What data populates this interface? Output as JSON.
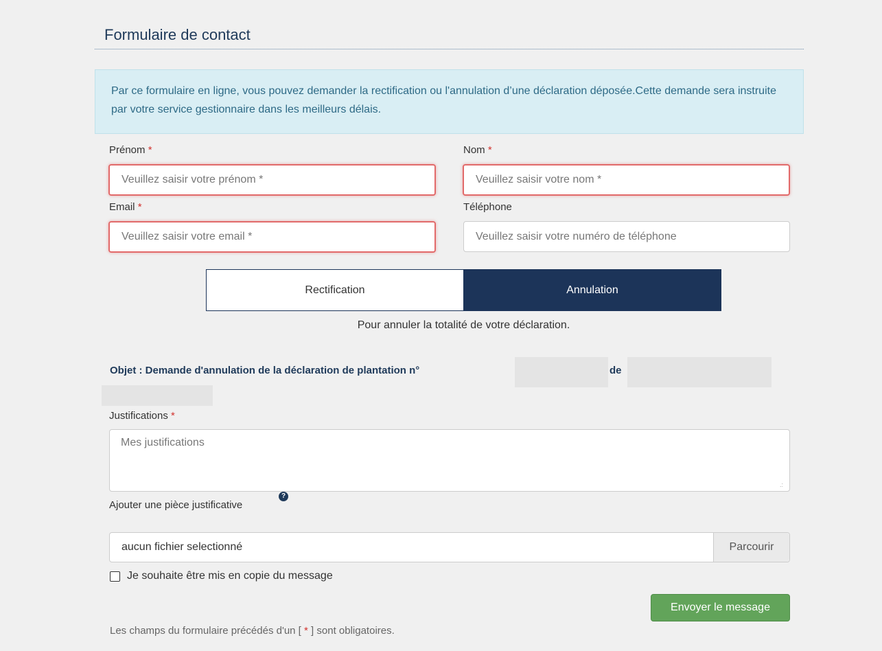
{
  "form": {
    "title": "Formulaire de contact",
    "info": "Par ce formulaire en ligne, vous pouvez demander la rectification ou l'annulation d’une déclaration déposée.Cette demande sera instruite par votre service gestionnaire dans les meilleurs délais.",
    "required_mark": "*",
    "fields": {
      "prenom": {
        "label": "Prénom",
        "placeholder": "Veuillez saisir votre prénom *",
        "required": true
      },
      "nom": {
        "label": "Nom",
        "placeholder": "Veuillez saisir votre nom *",
        "required": true
      },
      "email": {
        "label": "Email",
        "placeholder": "Veuillez saisir votre email *",
        "required": true
      },
      "telephone": {
        "label": "Téléphone",
        "placeholder": "Veuillez saisir votre numéro de téléphone",
        "required": false
      }
    },
    "toggle": {
      "options": [
        "Rectification",
        "Annulation"
      ],
      "selected": "Annulation",
      "hint": "Pour annuler la totalité de votre déclaration."
    },
    "objet": {
      "text": "Objet : Demande d'annulation de la déclaration de plantation n°",
      "connector": "de"
    },
    "justifications": {
      "label": "Justifications",
      "placeholder": "Mes justifications"
    },
    "attachment": {
      "label": "Ajouter une pièce justificative",
      "help_icon": "question-circle-icon",
      "help_glyph": "?",
      "file_text": "aucun fichier selectionné",
      "browse_label": "Parcourir"
    },
    "copy_checkbox": {
      "label": "Je souhaite être mis en copie du message",
      "checked": false
    },
    "submit_label": "Envoyer le message",
    "footnote_before": "Les champs du formulaire précédés d'un [",
    "footnote_after": "] sont obligatoires."
  },
  "colors": {
    "title": "#1f3a5a",
    "info_bg": "#d9eef4",
    "info_text": "#2e6a86",
    "required": "#d2332f",
    "error_border": "#e26a6a",
    "toggle_active": "#1c3459",
    "submit": "#62a45a"
  }
}
